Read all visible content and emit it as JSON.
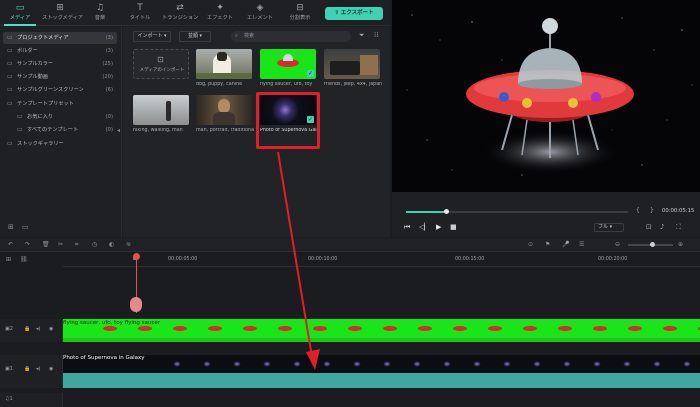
{
  "tabs": [
    {
      "icon": "media-icon",
      "label": "メディア"
    },
    {
      "icon": "stock-icon",
      "label": "ストックメディア"
    },
    {
      "icon": "audio-icon",
      "label": "音楽"
    },
    {
      "icon": "title-icon",
      "label": "タイトル"
    },
    {
      "icon": "transition-icon",
      "label": "トランジション"
    },
    {
      "icon": "effect-icon",
      "label": "エフェクト"
    },
    {
      "icon": "element-icon",
      "label": "エレメント"
    },
    {
      "icon": "split-icon",
      "label": "分割表示"
    }
  ],
  "export_label": "エクスポート",
  "sidebar": [
    {
      "label": "プロジェクトメディア",
      "count": "(3)"
    },
    {
      "label": "ボルダー",
      "count": "(3)"
    },
    {
      "label": "サンプルカラー",
      "count": "(25)"
    },
    {
      "label": "サンプル動画",
      "count": "(20)"
    },
    {
      "label": "サンプルグリーンスクリーン",
      "count": "(6)"
    },
    {
      "label": "テンプレートプリセット",
      "count": ""
    },
    {
      "label": "お気に入り",
      "count": "(0)"
    },
    {
      "label": "すべてのテンプレート",
      "count": "(0)"
    },
    {
      "label": "ストックギャラリー",
      "count": ""
    }
  ],
  "media": {
    "import_label": "インポート",
    "sort_label": "並順",
    "search_placeholder": "検索",
    "items": [
      {
        "label": "メディアのインポート"
      },
      {
        "label": "dog, puppy, canine"
      },
      {
        "label": "flying saucer, ufo, toy"
      },
      {
        "label": "friends, jeep, 4x4, japan"
      },
      {
        "label": "hiking, walking, man"
      },
      {
        "label": "man, portrait, traditional"
      },
      {
        "label": "Photo of Supernova Galaxy"
      }
    ]
  },
  "preview": {
    "timecode": "00:00:05:15",
    "quality": "フル"
  },
  "timeline": {
    "ruler": [
      "00:00:05:00",
      "00:00:10:00",
      "00:00:15:00",
      "00:00:20:00"
    ],
    "track2_label": "flying saucer, ufo, toy flying saucer",
    "track1_label": "Photo of Supernova in Galaxy"
  }
}
